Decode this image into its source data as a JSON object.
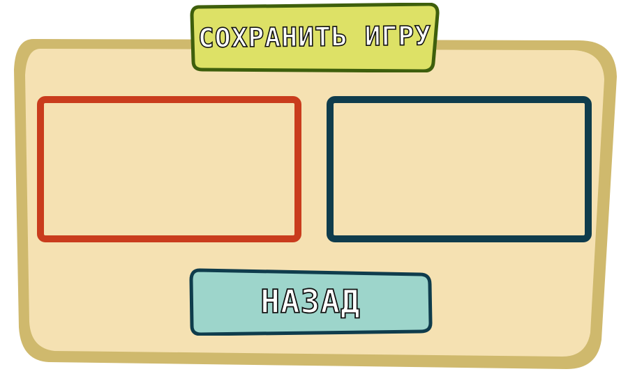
{
  "title": "СОХРАНИТЬ ИГРУ",
  "save_slots": [
    {
      "id": "slot-1",
      "border_color": "#c93c1d",
      "content": ""
    },
    {
      "id": "slot-2",
      "border_color": "#0f3c4c",
      "content": ""
    }
  ],
  "back_button": {
    "label": "НАЗАД"
  },
  "colors": {
    "panel_fill": "#f5e1b2",
    "panel_border": "#cfb96d",
    "title_fill": "#dde166",
    "title_border": "#3e5f0c",
    "back_fill": "#9dd5cb",
    "back_border": "#0f3c4c"
  }
}
